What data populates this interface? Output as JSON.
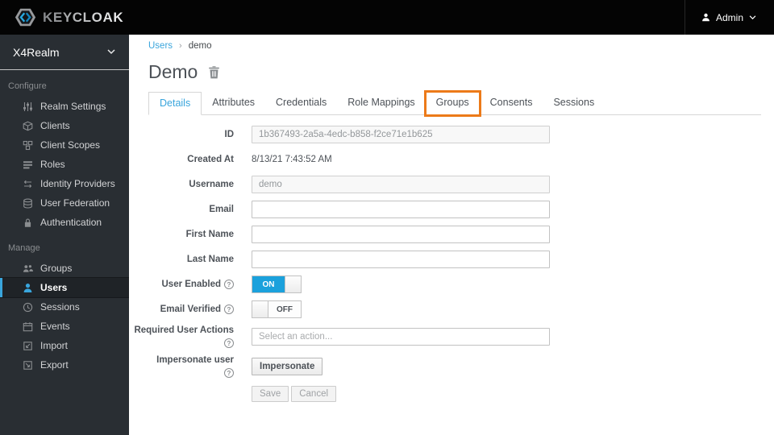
{
  "header": {
    "brand": "KEYCLOAK",
    "admin_label": "Admin"
  },
  "sidebar": {
    "realm": "X4Realm",
    "sections": [
      {
        "label": "Configure",
        "items": [
          {
            "label": "Realm Settings",
            "icon": "sliders-icon"
          },
          {
            "label": "Clients",
            "icon": "cube-icon"
          },
          {
            "label": "Client Scopes",
            "icon": "cubes-icon"
          },
          {
            "label": "Roles",
            "icon": "list-bars-icon"
          },
          {
            "label": "Identity Providers",
            "icon": "exchange-arrows-icon"
          },
          {
            "label": "User Federation",
            "icon": "database-icon"
          },
          {
            "label": "Authentication",
            "icon": "lock-icon"
          }
        ]
      },
      {
        "label": "Manage",
        "items": [
          {
            "label": "Groups",
            "icon": "users-group-icon"
          },
          {
            "label": "Users",
            "icon": "user-icon",
            "active": true
          },
          {
            "label": "Sessions",
            "icon": "clock-icon"
          },
          {
            "label": "Events",
            "icon": "calendar-icon"
          },
          {
            "label": "Import",
            "icon": "import-icon"
          },
          {
            "label": "Export",
            "icon": "export-icon"
          }
        ]
      }
    ]
  },
  "breadcrumb": {
    "items": [
      "Users",
      "demo"
    ]
  },
  "page": {
    "title": "Demo",
    "delete_icon": "trash-icon"
  },
  "tabs": [
    {
      "label": "Details",
      "active": true
    },
    {
      "label": "Attributes"
    },
    {
      "label": "Credentials"
    },
    {
      "label": "Role Mappings"
    },
    {
      "label": "Groups",
      "highlighted": true
    },
    {
      "label": "Consents"
    },
    {
      "label": "Sessions"
    }
  ],
  "form": {
    "id": {
      "label": "ID",
      "value": "1b367493-2a5a-4edc-b858-f2ce71e1b625"
    },
    "created_at": {
      "label": "Created At",
      "value": "8/13/21 7:43:52 AM"
    },
    "username": {
      "label": "Username",
      "value": "demo"
    },
    "email": {
      "label": "Email",
      "value": ""
    },
    "first_name": {
      "label": "First Name",
      "value": ""
    },
    "last_name": {
      "label": "Last Name",
      "value": ""
    },
    "user_enabled": {
      "label": "User Enabled",
      "state": "ON"
    },
    "email_verified": {
      "label": "Email Verified",
      "state": "OFF"
    },
    "required_actions": {
      "label": "Required User Actions",
      "placeholder": "Select an action..."
    },
    "impersonate": {
      "label": "Impersonate user",
      "button_label": "Impersonate"
    },
    "save_label": "Save",
    "cancel_label": "Cancel"
  },
  "colors": {
    "accent_blue": "#39a5dc",
    "toggle_on_blue": "#1ba1dc",
    "highlight_orange": "#ec7a19",
    "sidebar_bg": "#292e33",
    "header_bg": "#040404"
  }
}
